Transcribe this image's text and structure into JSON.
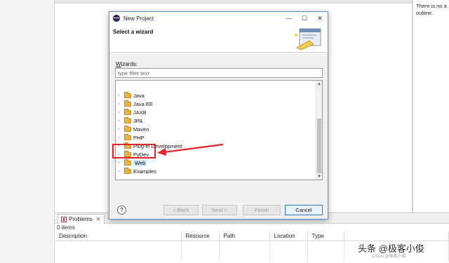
{
  "outline": {
    "line1": "There is no a",
    "line2": "outline."
  },
  "problems": {
    "tab_label": "Problems",
    "close_glyph": "✕",
    "count": "0 items",
    "columns": [
      "Description",
      "Resource",
      "Path",
      "Location",
      "Type"
    ]
  },
  "dialog": {
    "title": "New Project",
    "controls": {
      "minimize": "—",
      "maximize": "☐",
      "close": "✕"
    },
    "banner_title": "Select a wizard",
    "wizards_label_mnemonic": "W",
    "wizards_label_rest": "izards:",
    "filter_placeholder": "type filter text",
    "tree": [
      {
        "label": "Java",
        "selected": false
      },
      {
        "label": "Java EE",
        "selected": false
      },
      {
        "label": "JAXB",
        "selected": false
      },
      {
        "label": "JPA",
        "selected": false
      },
      {
        "label": "Maven",
        "selected": false
      },
      {
        "label": "PHP",
        "selected": false
      },
      {
        "label": "Plug-in Development",
        "selected": false
      },
      {
        "label": "PyDev",
        "selected": false
      },
      {
        "label": "Web",
        "selected": true
      },
      {
        "label": "Examples",
        "selected": false
      }
    ],
    "buttons": {
      "help": "?",
      "back": "< Back",
      "next": "Next >",
      "finish": "Finish",
      "cancel": "Cancel"
    }
  },
  "annotation_color": "#e0242a",
  "watermark": {
    "main": "头条 @极客小俊",
    "small": "CSDN @极客小俊"
  }
}
